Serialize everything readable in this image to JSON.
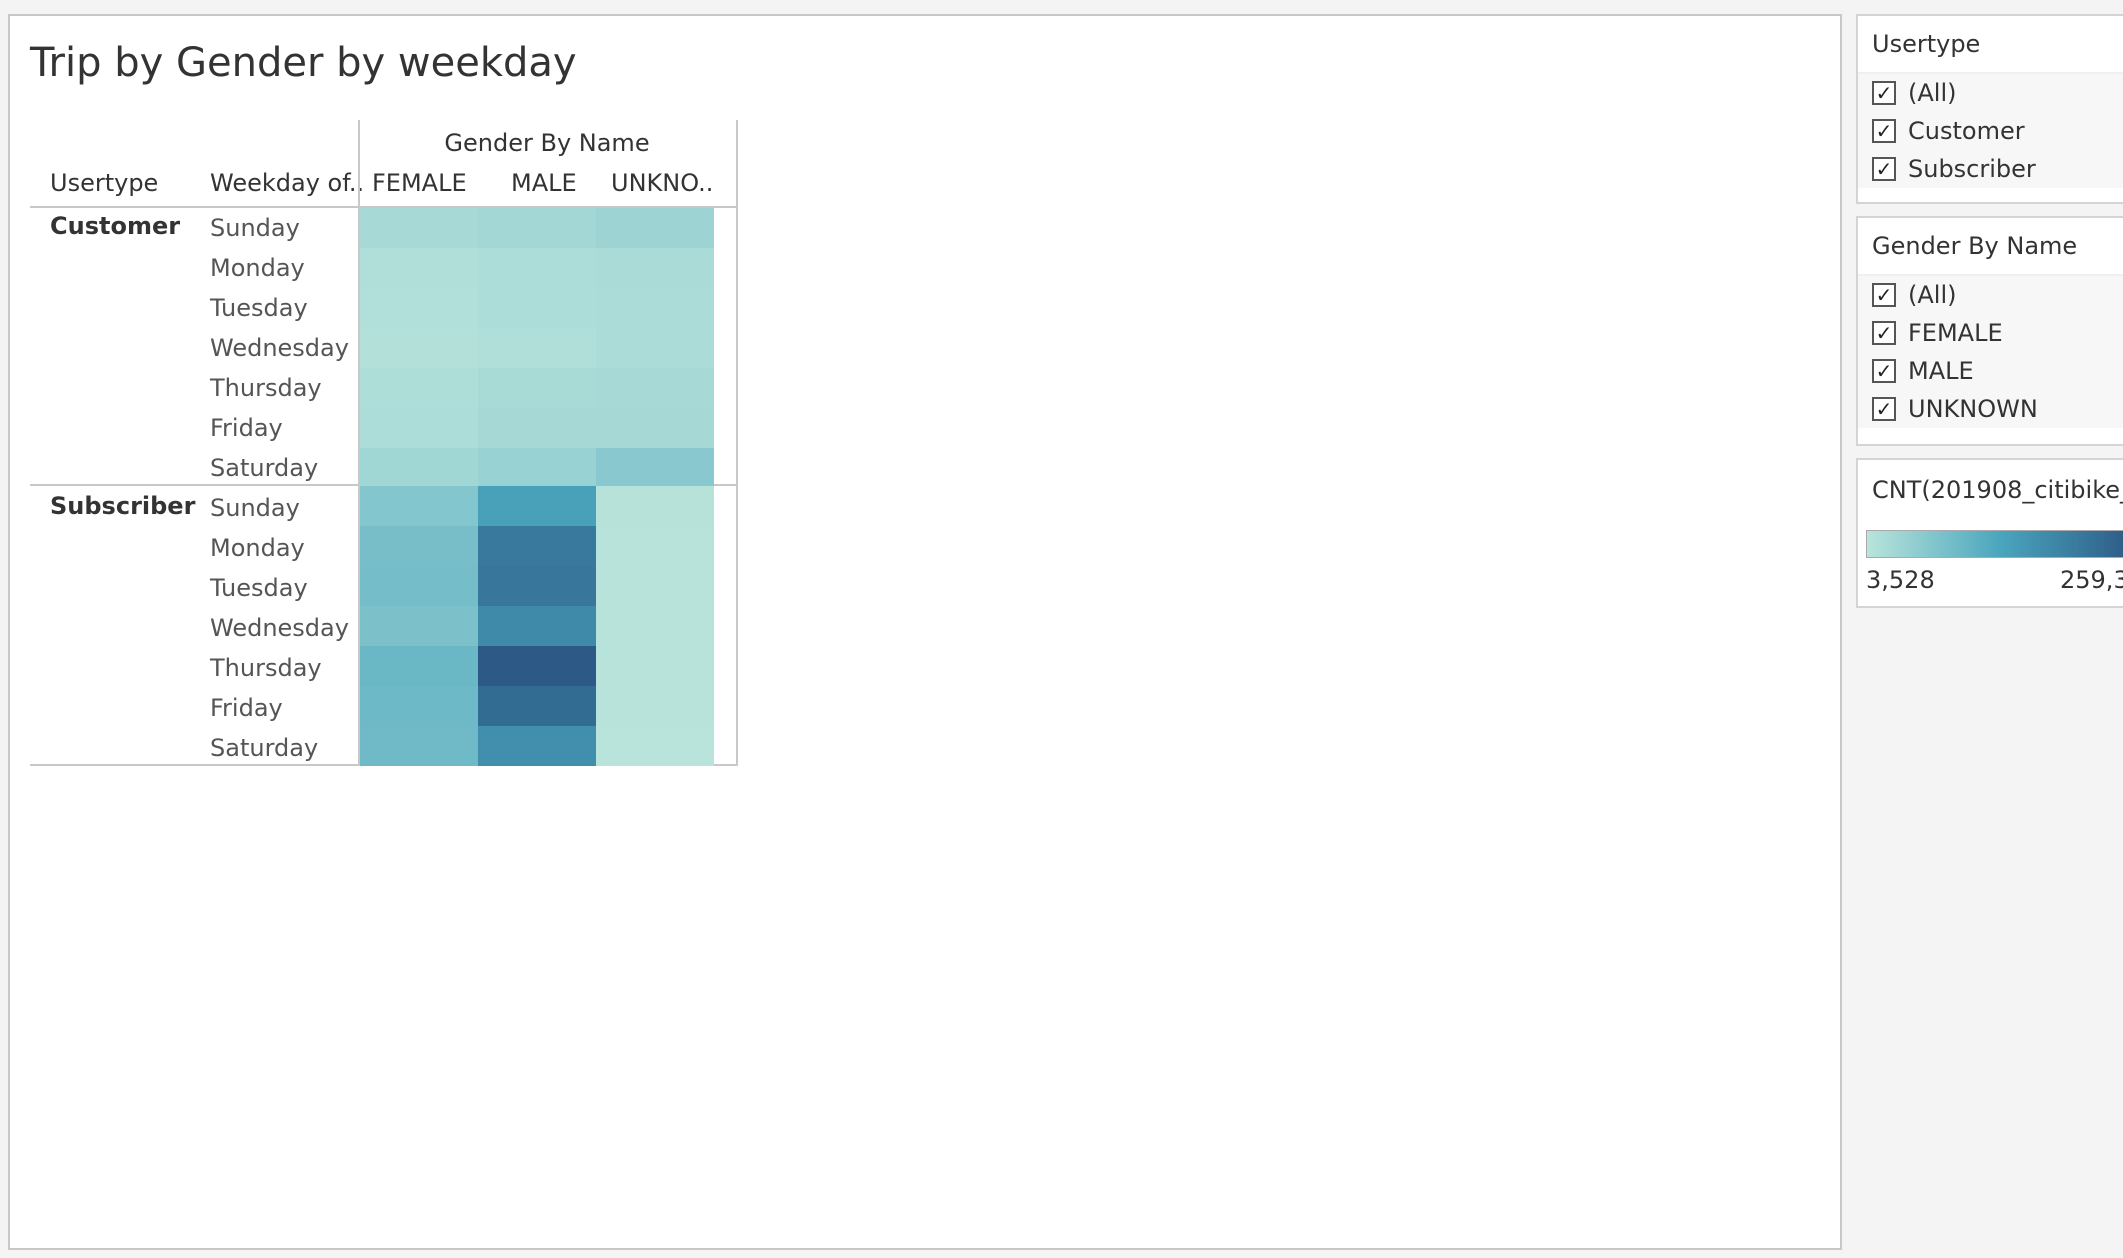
{
  "title": "Trip by Gender by weekday",
  "table": {
    "group_header": "Gender By Name",
    "row_headers": [
      "Usertype",
      "Weekday of.."
    ],
    "columns": [
      "FEMALE",
      "MALE",
      "UNKNO.."
    ],
    "groups": [
      {
        "usertype": "Customer",
        "days": [
          "Sunday",
          "Monday",
          "Tuesday",
          "Wednesday",
          "Thursday",
          "Friday",
          "Saturday"
        ]
      },
      {
        "usertype": "Subscriber",
        "days": [
          "Sunday",
          "Monday",
          "Tuesday",
          "Wednesday",
          "Thursday",
          "Friday",
          "Saturday"
        ]
      }
    ]
  },
  "chart_data": {
    "type": "heatmap",
    "title": "Trip by Gender by weekday",
    "columns": [
      "FEMALE",
      "MALE",
      "UNKNO.."
    ],
    "rows": [
      {
        "usertype": "Customer",
        "weekday": "Sunday",
        "values": [
          24000,
          30000,
          36000
        ]
      },
      {
        "usertype": "Customer",
        "weekday": "Monday",
        "values": [
          14000,
          18000,
          21000
        ]
      },
      {
        "usertype": "Customer",
        "weekday": "Tuesday",
        "values": [
          13000,
          17000,
          20000
        ]
      },
      {
        "usertype": "Customer",
        "weekday": "Wednesday",
        "values": [
          11000,
          14000,
          19000
        ]
      },
      {
        "usertype": "Customer",
        "weekday": "Thursday",
        "values": [
          16000,
          23000,
          24000
        ]
      },
      {
        "usertype": "Customer",
        "weekday": "Friday",
        "values": [
          17000,
          25000,
          25000
        ]
      },
      {
        "usertype": "Customer",
        "weekday": "Saturday",
        "values": [
          32000,
          41000,
          60000
        ]
      },
      {
        "usertype": "Subscriber",
        "weekday": "Sunday",
        "values": [
          65000,
          140000,
          7000
        ]
      },
      {
        "usertype": "Subscriber",
        "weekday": "Monday",
        "values": [
          80000,
          205000,
          6000
        ]
      },
      {
        "usertype": "Subscriber",
        "weekday": "Tuesday",
        "values": [
          82000,
          208000,
          6000
        ]
      },
      {
        "usertype": "Subscriber",
        "weekday": "Wednesday",
        "values": [
          74000,
          178000,
          6000
        ]
      },
      {
        "usertype": "Subscriber",
        "weekday": "Thursday",
        "values": [
          95000,
          259300,
          6000
        ]
      },
      {
        "usertype": "Subscriber",
        "weekday": "Friday",
        "values": [
          90000,
          228000,
          6000
        ]
      },
      {
        "usertype": "Subscriber",
        "weekday": "Saturday",
        "values": [
          88000,
          168000,
          3528
        ]
      }
    ],
    "color_range": [
      3528,
      259300
    ],
    "colors": [
      "#b9e4db",
      "#4aa5bd",
      "#2c5985"
    ]
  },
  "filters": [
    {
      "title": "Usertype",
      "options": [
        "(All)",
        "Customer",
        "Subscriber"
      ]
    },
    {
      "title": "Gender By Name",
      "options": [
        "(All)",
        "FEMALE",
        "MALE",
        "UNKNOWN"
      ]
    }
  ],
  "legend": {
    "title": "CNT(201908_citibike_",
    "min_label": "3,528",
    "max_label": "259,3"
  }
}
